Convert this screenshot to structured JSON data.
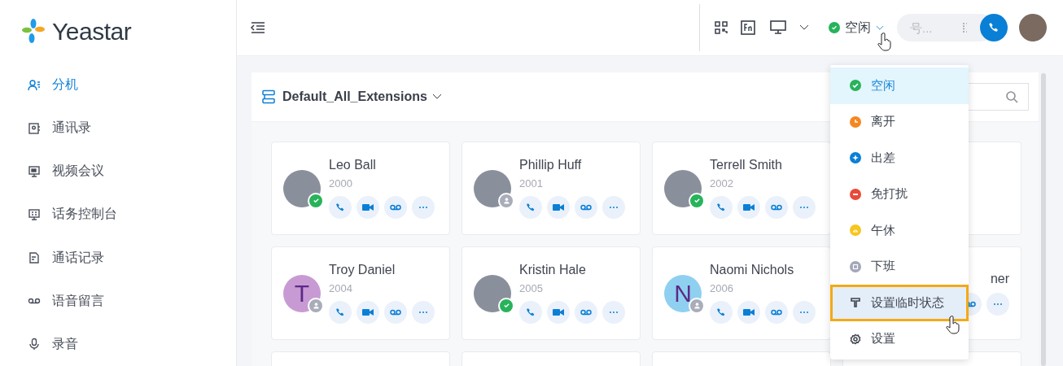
{
  "brand": {
    "name": "Yeastar"
  },
  "sidebar": {
    "items": [
      {
        "label": "分机",
        "selected": true
      },
      {
        "label": "通讯录",
        "selected": false
      },
      {
        "label": "视频会议",
        "selected": false
      },
      {
        "label": "话务控制台",
        "selected": false
      },
      {
        "label": "通话记录",
        "selected": false
      },
      {
        "label": "语音留言",
        "selected": false
      },
      {
        "label": "录音",
        "selected": false
      }
    ]
  },
  "header": {
    "status": {
      "label": "空闲",
      "color": "#27b35a"
    },
    "dial": {
      "placeholder": "号..."
    }
  },
  "panel": {
    "title": "Default_All_Extensions"
  },
  "contacts": [
    {
      "kind": "photo",
      "name": "Leo Ball",
      "ext": "2000",
      "online": true
    },
    {
      "kind": "photo",
      "name": "Phillip Huff",
      "ext": "2001",
      "online": false
    },
    {
      "kind": "photo",
      "name": "Terrell Smith",
      "ext": "2002",
      "online": true
    },
    {
      "kind": "covered"
    },
    {
      "kind": "letter",
      "name": "Troy Daniel",
      "ext": "2004",
      "letter": "T",
      "color": "#c89ad4",
      "online": false
    },
    {
      "kind": "photo",
      "name": "Kristin Hale",
      "ext": "2005",
      "online": true
    },
    {
      "kind": "letter",
      "name": "Naomi Nichols",
      "ext": "2006",
      "letter": "N",
      "color": "#8fd0f0",
      "online": false
    },
    {
      "kind": "covered",
      "name": "ner"
    },
    {
      "kind": "covered"
    },
    {
      "kind": "covered"
    },
    {
      "kind": "covered"
    },
    {
      "kind": "covered"
    }
  ],
  "status_menu": {
    "items": [
      {
        "kind": "status",
        "label": "空闲",
        "color": "#27b35a",
        "selected": true,
        "hovered": false
      },
      {
        "kind": "status",
        "label": "离开",
        "color": "#f5871f",
        "selected": false,
        "hovered": false
      },
      {
        "kind": "status",
        "label": "出差",
        "color": "#0a7fd6",
        "selected": false,
        "hovered": false
      },
      {
        "kind": "status",
        "label": "免打扰",
        "color": "#e84a3b",
        "selected": false,
        "hovered": false
      },
      {
        "kind": "status",
        "label": "午休",
        "color": "#f7c51e",
        "selected": false,
        "hovered": false
      },
      {
        "kind": "status",
        "label": "下班",
        "color": "#a3a7b8",
        "selected": false,
        "hovered": false
      },
      {
        "kind": "custom",
        "label": "设置临时状态",
        "selected": false,
        "hovered": true
      },
      {
        "kind": "settings",
        "label": "设置",
        "selected": false,
        "hovered": false
      }
    ]
  }
}
